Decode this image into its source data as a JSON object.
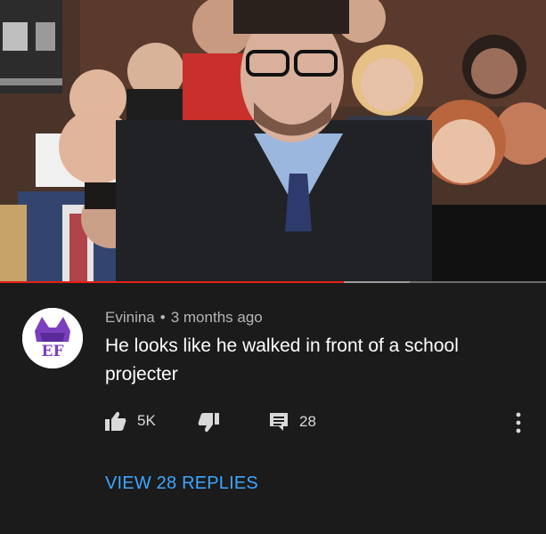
{
  "video": {
    "progress_fraction": 0.63,
    "buffered_fraction": 0.75,
    "colors": {
      "played": "#e62117",
      "buffered": "#9c9c9c",
      "track": "#6e6e6e"
    }
  },
  "comment": {
    "avatar_text": "EF",
    "author": "Evinina",
    "separator": "•",
    "timestamp": "3 months ago",
    "text": "He looks like he walked in front of a school projecter",
    "likes": "5K",
    "replies_count": "28",
    "view_replies_label": "VIEW 28 REPLIES",
    "icons": {
      "like": "thumbs-up-icon",
      "dislike": "thumbs-down-icon",
      "reply": "comment-icon",
      "more": "more-vertical-icon"
    },
    "colors": {
      "link": "#3ea6ff",
      "meta": "#b5b5b5",
      "avatar_purple": "#7b3fbf"
    }
  }
}
